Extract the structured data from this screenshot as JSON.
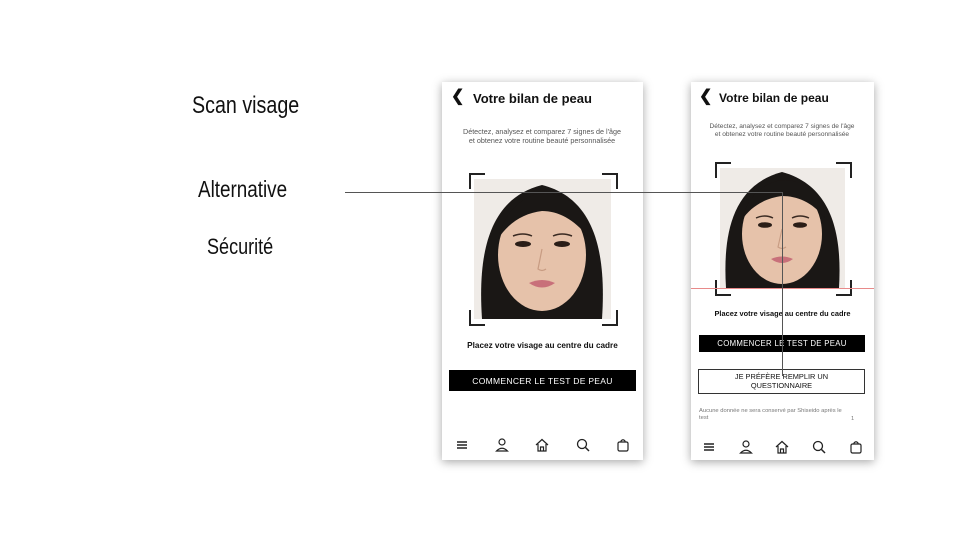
{
  "left_labels": {
    "title": "Scan visage",
    "alternative": "Alternative",
    "security": "Sécurité"
  },
  "screen_a": {
    "header_title": "Votre bilan de peau",
    "intro": "Détectez, analysez et comparez 7 signes de l'âge et obtenez votre routine beauté personnalisée",
    "instruction": "Placez votre visage au centre du cadre",
    "cta_label": "COMMENCER LE TEST DE PEAU",
    "nav_icons": [
      "menu-icon",
      "user-icon",
      "home-icon",
      "search-icon",
      "bag-icon"
    ]
  },
  "screen_b": {
    "header_title": "Votre bilan de peau",
    "intro": "Détectez, analysez et comparez 7 signes de l'âge et obtenez votre routine beauté personnalisée",
    "instruction": "Placez votre visage au centre du cadre",
    "cta_label": "COMMENCER LE TEST DE PEAU",
    "questionnaire_label": "JE PRÉFÈRE REMPLIR UN QUESTIONNAIRE",
    "disclaimer": "Aucune donnée ne sera conservé par Shiseido après le test",
    "disclaimer_count": "1",
    "nav_icons": [
      "menu-icon",
      "user-icon",
      "home-icon",
      "search-icon",
      "bag-icon"
    ]
  },
  "colors": {
    "accent_line": "#e88a8a",
    "cta_bg": "#000000",
    "cta_text": "#ffffff"
  }
}
